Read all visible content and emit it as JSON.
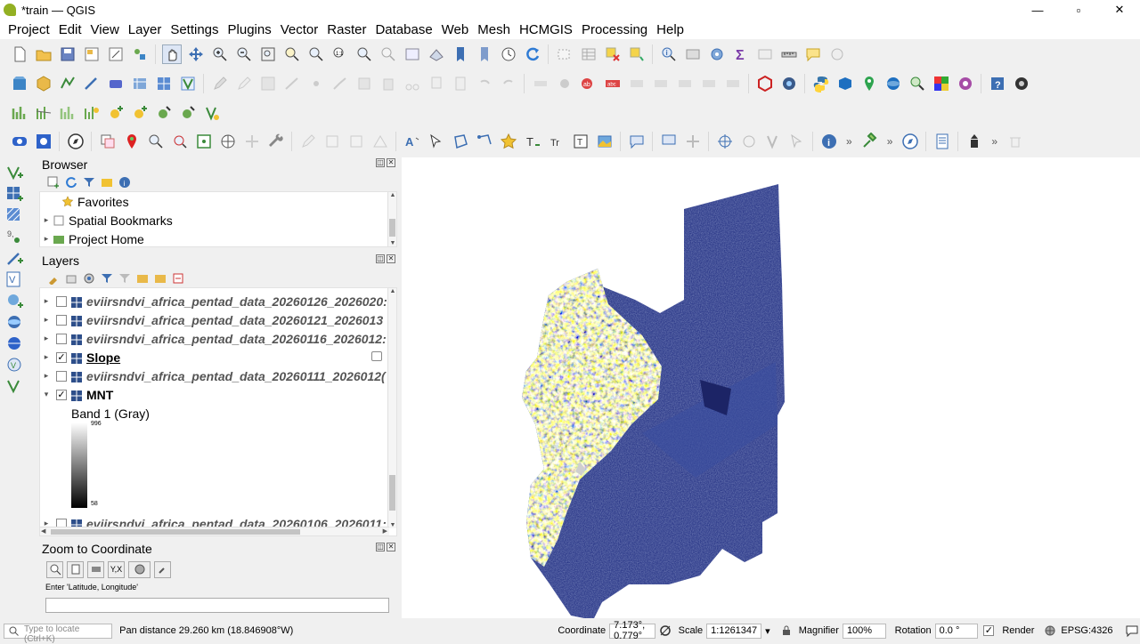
{
  "window": {
    "title": "*train — QGIS",
    "minimize": "—",
    "maximize": "▫",
    "close": "✕"
  },
  "menu": [
    "Project",
    "Edit",
    "View",
    "Layer",
    "Settings",
    "Plugins",
    "Vector",
    "Raster",
    "Database",
    "Web",
    "Mesh",
    "HCMGIS",
    "Processing",
    "Help"
  ],
  "browser": {
    "title": "Browser",
    "items": [
      {
        "label": "Favorites",
        "icon": "star-icon"
      },
      {
        "label": "Spatial Bookmarks",
        "icon": "bookmark-icon"
      },
      {
        "label": "Project Home",
        "icon": "folder-icon"
      }
    ]
  },
  "layers": {
    "title": "Layers",
    "items": [
      {
        "name": "eviirsndvi_africa_pentad_data_20260126_2026020:",
        "checked": false,
        "style": "italic"
      },
      {
        "name": "eviirsndvi_africa_pentad_data_20260121_2026013",
        "checked": false,
        "style": "italic"
      },
      {
        "name": "eviirsndvi_africa_pentad_data_20260116_2026012:",
        "checked": false,
        "style": "italic"
      },
      {
        "name": "Slope",
        "checked": true,
        "style": "active"
      },
      {
        "name": "eviirsndvi_africa_pentad_data_20260111_2026012(",
        "checked": false,
        "style": "italic"
      },
      {
        "name": "MNT",
        "checked": true,
        "style": "plain",
        "expanded": true
      }
    ],
    "mnt_band": "Band 1 (Gray)",
    "legend_max": "996",
    "legend_min": "58",
    "last_item": {
      "name": "eviirsndvi_africa_pentad_data_20260106_2026011:",
      "checked": false
    }
  },
  "zoom_panel": {
    "title": "Zoom to Coordinate",
    "hint": "Enter 'Latitude, Longitude'",
    "input_value": ""
  },
  "status": {
    "locator_placeholder": "Type to locate (Ctrl+K)",
    "message": "Pan distance 29.260 km (18.846908°W)",
    "coordinate_label": "Coordinate",
    "coordinate": "7.173°, 0.779°",
    "scale_label": "Scale",
    "scale": "1:1261347",
    "magnifier_label": "Magnifier",
    "magnifier": "100%",
    "rotation_label": "Rotation",
    "rotation": "0.0 °",
    "render_label": "Render",
    "crs": "EPSG:4326"
  },
  "colors": {
    "accent": "#93b023",
    "map_dark": "#2e3b8a"
  }
}
